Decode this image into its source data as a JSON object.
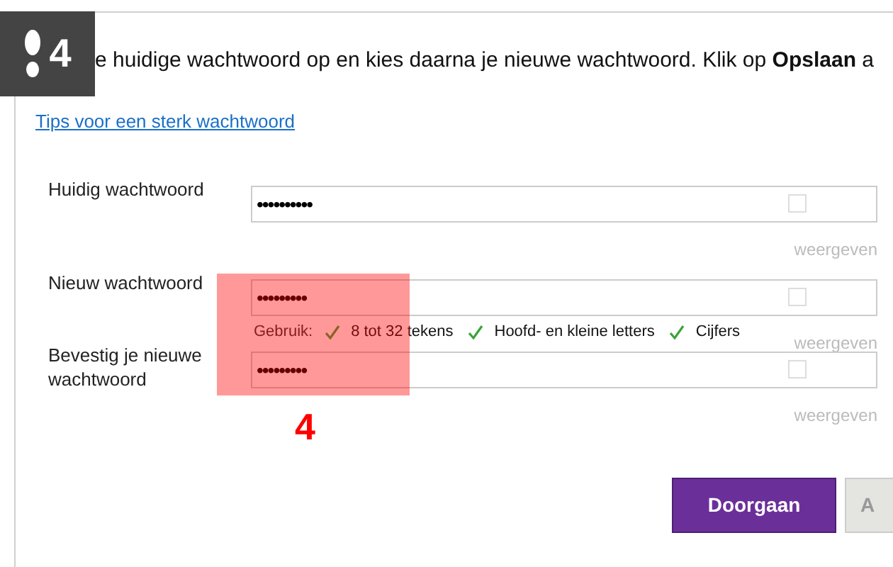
{
  "step_badge": {
    "number": "4"
  },
  "intro": "e huidige wachtwoord op en kies daarna je nieuwe wachtwoord. Klik op **Opslaan** a",
  "tips_link": "Tips voor een sterk wachtwoord",
  "fields": [
    {
      "label": "Huidig wachtwoord",
      "value": "••••••••••",
      "show_checked": false,
      "show_label": "weergeven"
    },
    {
      "label": "Nieuw wachtwoord",
      "value": "•••••••••",
      "show_checked": false,
      "show_label": "weergeven",
      "hints": {
        "title": "Gebruik:",
        "rules": [
          {
            "text": "8 tot 32 tekens",
            "met": true
          },
          {
            "text": "Hoofd- en kleine letters",
            "met": true
          },
          {
            "text": "Cijfers",
            "met": true
          }
        ]
      }
    },
    {
      "label": "Bevestig je nieuwe wachtwoord",
      "value": "•••••••••",
      "show_checked": false,
      "show_label": "weergeven"
    }
  ],
  "annotation": {
    "number": "4"
  },
  "buttons": [
    {
      "label": "Doorgaan",
      "kind": "primary"
    },
    {
      "label": "A",
      "kind": "secondary"
    }
  ]
}
